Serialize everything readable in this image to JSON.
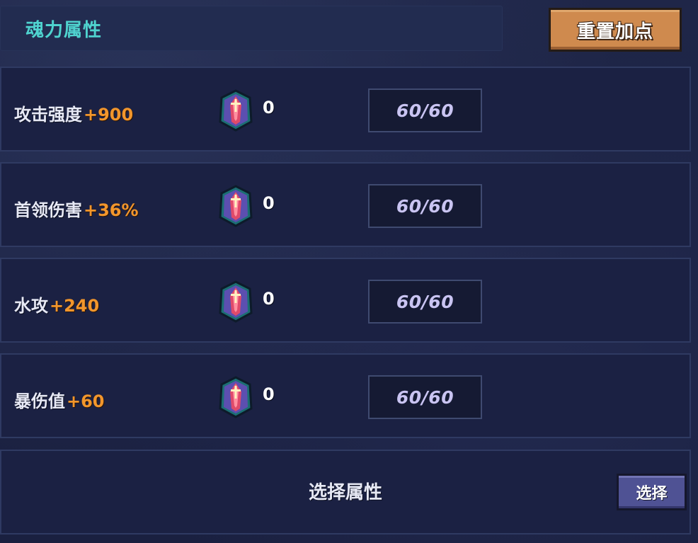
{
  "header": {
    "title": "魂力属性",
    "reset_button_label": "重置加点"
  },
  "attributes": [
    {
      "name": "攻击强度",
      "bonus": "+900",
      "gem_icon": "soul-crystal-icon",
      "gem_count": "0",
      "progress": "60/60"
    },
    {
      "name": "首领伤害",
      "bonus": "+36%",
      "gem_icon": "soul-crystal-icon",
      "gem_count": "0",
      "progress": "60/60"
    },
    {
      "name": "水攻",
      "bonus": "+240",
      "gem_icon": "soul-crystal-icon",
      "gem_count": "0",
      "progress": "60/60"
    },
    {
      "name": "暴伤值",
      "bonus": "+60",
      "gem_icon": "soul-crystal-icon",
      "gem_count": "0",
      "progress": "60/60"
    }
  ],
  "select": {
    "label": "选择属性",
    "button_label": "选择"
  },
  "colors": {
    "title": "#4fd3cf",
    "bonus": "#f2962c",
    "reset_button": "#cf8a4e",
    "choose_button": "#4f5294",
    "progress_text": "#c9c4f2"
  }
}
